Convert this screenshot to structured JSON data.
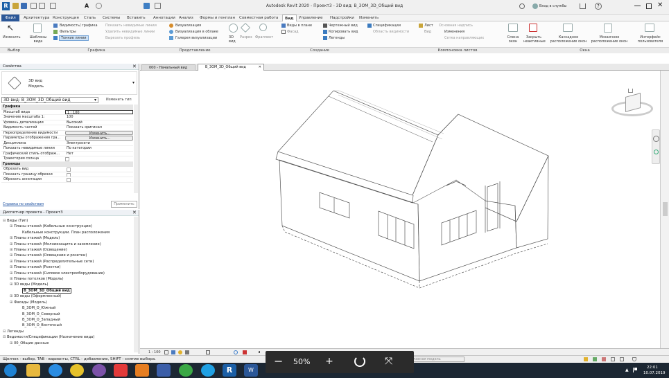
{
  "title": "Autodesk Revit 2020 - Проект3 - 3D вид: В_3ОМ_3D_Общий вид",
  "signin": "Вход в службы",
  "menu": [
    "Файл",
    "Архитектура",
    "Конструкция",
    "Сталь",
    "Системы",
    "Вставить",
    "Аннотации",
    "Анализ",
    "Формы и генплан",
    "Совместная работа",
    "Вид",
    "Управление",
    "Надстройки",
    "Изменить"
  ],
  "active_tab": "Вид",
  "ribbon": {
    "modify": "Изменить",
    "templates": "Шаблоны вида",
    "thin_lines": "Тонкие линии",
    "visibility": "Видимость/ графика",
    "filters": "Фильтры",
    "hide_lines": "Показать невидимые линии",
    "remove_hidden": "Удалить невидимые линии",
    "cut_profile": "Вырезать профиль",
    "render": "Визуализация",
    "cloud_render": "Визуализация в облаке",
    "render_gallery": "Галерея визуализации",
    "view3d": "3D вид",
    "section": "Разрез",
    "callout": "Фрагмент",
    "plan_views": "Виды в плане",
    "elevation": "Фасад",
    "drafting_view": "Чертежный вид",
    "duplicate_view": "Копировать вид",
    "legends": "Легенды",
    "schedules": "Спецификации",
    "scope_box": "Область видимости",
    "sheet": "Лист",
    "title_block": "Основная надпись",
    "view_ref": "Вид",
    "revisions": "Изменения",
    "guide_grid": "Сетка направляющих",
    "switch_windows": "Смена окон",
    "close_inactive": "Закрыть неактивные",
    "tab_views": "Каскадное расположение окон",
    "tile_views": "Мозаичное расположение окон",
    "user_interface": "Интерфейс пользователя",
    "groups": [
      "Выбор",
      "Графика",
      "Представление",
      "Создание",
      "Компоновка листов",
      "Окна"
    ]
  },
  "properties": {
    "header": "Свойства",
    "type_line1": "3D вид",
    "type_line2": "Модель",
    "selector": "3D вид: В_3ОМ_3D_Общий вид",
    "edit_type": "Изменить тип",
    "section_graphics": "Графика",
    "section_bounds": "Границы",
    "rows": [
      {
        "k": "Масштаб вида",
        "v": "1 : 100"
      },
      {
        "k": "Значение масштаба 1:",
        "v": "100"
      },
      {
        "k": "Уровень детализации",
        "v": "Высокий"
      },
      {
        "k": "Видимость частей",
        "v": "Показать оригинал"
      },
      {
        "k": "Переопределение видимости",
        "v": "Изменить..."
      },
      {
        "k": "Параметры отображения гра...",
        "v": "Изменить..."
      },
      {
        "k": "Дисциплина",
        "v": "Электросети"
      },
      {
        "k": "Показать невидимые линии",
        "v": "По категории"
      },
      {
        "k": "Графический стиль отобрaж...",
        "v": "Нет"
      },
      {
        "k": "Траектория солнца",
        "v": ""
      }
    ],
    "bounds_rows": [
      "Обрезать вид",
      "Показать границу обрезки",
      "Обрезать аннотации"
    ],
    "help": "Справка по свойствам",
    "apply": "Применить"
  },
  "browser": {
    "header": "Диспетчер проекта - Проект3",
    "items": [
      {
        "t": "Виды (Тип)",
        "l": 0
      },
      {
        "t": "Планы этажей (Кабельные конструкции)",
        "l": 1
      },
      {
        "t": "Кабельные конструкции. План расположения",
        "l": 2
      },
      {
        "t": "Планы этажей (Модель)",
        "l": 1
      },
      {
        "t": "Планы этажей (Молниезащита и заземление)",
        "l": 1
      },
      {
        "t": "Планы этажей (Освещение)",
        "l": 1
      },
      {
        "t": "Планы этажей (Освещение и розетки)",
        "l": 1
      },
      {
        "t": "Планы этажей (Распределительные сети)",
        "l": 1
      },
      {
        "t": "Планы этажей (Розетки)",
        "l": 1
      },
      {
        "t": "Планы этажей (Силовое электрооборудование)",
        "l": 1
      },
      {
        "t": "Планы потолков (Модель)",
        "l": 1
      },
      {
        "t": "3D виды (Модель)",
        "l": 1
      },
      {
        "t": "В_3ОМ_3D_Общий вид",
        "l": 2,
        "sel": true
      },
      {
        "t": "3D виды (Оформленный)",
        "l": 1
      },
      {
        "t": "Фасады (Модель)",
        "l": 1
      },
      {
        "t": "В_3ОМ_О_Южный",
        "l": 2
      },
      {
        "t": "В_3ОМ_О_Северный",
        "l": 2
      },
      {
        "t": "В_3ОМ_О_Западный",
        "l": 2
      },
      {
        "t": "В_3ОМ_О_Восточный",
        "l": 2
      },
      {
        "t": "Легенды",
        "l": 0
      },
      {
        "t": "Ведомости/Спецификации (Назначение вида)",
        "l": 0
      },
      {
        "t": "00_Общие данные",
        "l": 1
      }
    ]
  },
  "viewtabs": [
    {
      "label": "000 - Начальный вид",
      "active": false
    },
    {
      "label": "В_3ОМ_3D_Общий вид",
      "active": true
    }
  ],
  "view_scale": "1 : 100",
  "status": "Щелчок - выбор, TAB - варианты, CTRL - добавление, SHIFT - снятие выбора.",
  "status_model": "Главная модель",
  "status_num": ":0",
  "zoom": "50%",
  "clock_time": "22:01",
  "clock_date": "10.07.2019",
  "lang": "RU"
}
